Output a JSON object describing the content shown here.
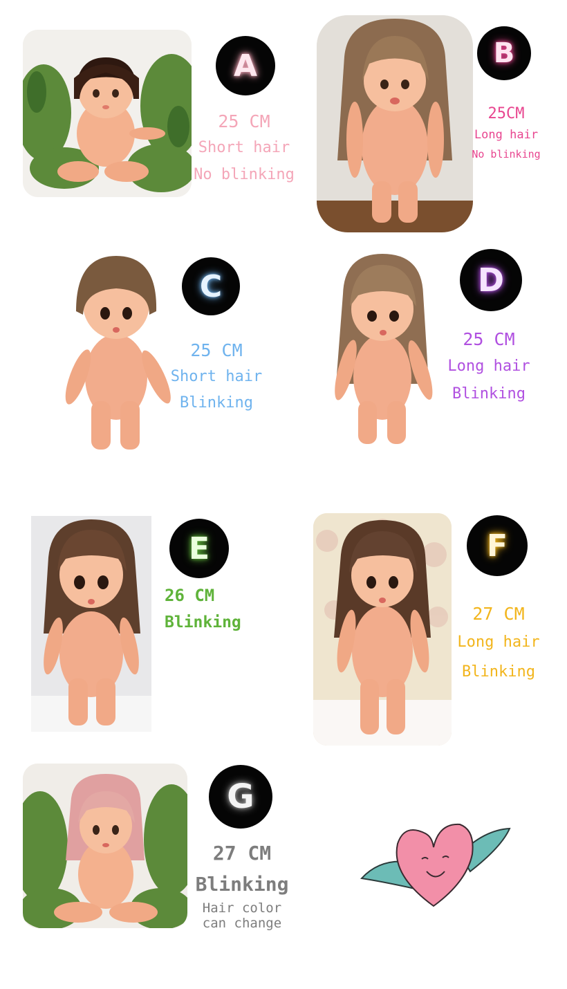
{
  "colors": {
    "A": "#f4a6b8",
    "B": "#e8458f",
    "C": "#6fb3ee",
    "D": "#b050e0",
    "E": "#5fb33a",
    "F": "#f2b51c",
    "G": "#7d7d7d",
    "heart": "#f28fa8",
    "wings": "#6cbcb6"
  },
  "dolls": [
    {
      "letter": "A",
      "lines": [
        "25 CM",
        "Short hair",
        "No blinking"
      ]
    },
    {
      "letter": "B",
      "lines": [
        "25CM",
        "Long hair",
        "No blinking"
      ]
    },
    {
      "letter": "C",
      "lines": [
        "25 CM",
        "Short hair",
        "Blinking"
      ]
    },
    {
      "letter": "D",
      "lines": [
        "25 CM",
        "Long hair",
        "Blinking"
      ]
    },
    {
      "letter": "E",
      "lines": [
        "26 CM",
        "Blinking"
      ]
    },
    {
      "letter": "F",
      "lines": [
        "27 CM",
        "Long hair",
        "Blinking"
      ]
    },
    {
      "letter": "G",
      "lines": [
        "27 CM",
        "Blinking",
        "Hair color",
        "can change"
      ]
    }
  ],
  "decoration": {
    "icon": "winged-heart-icon"
  }
}
